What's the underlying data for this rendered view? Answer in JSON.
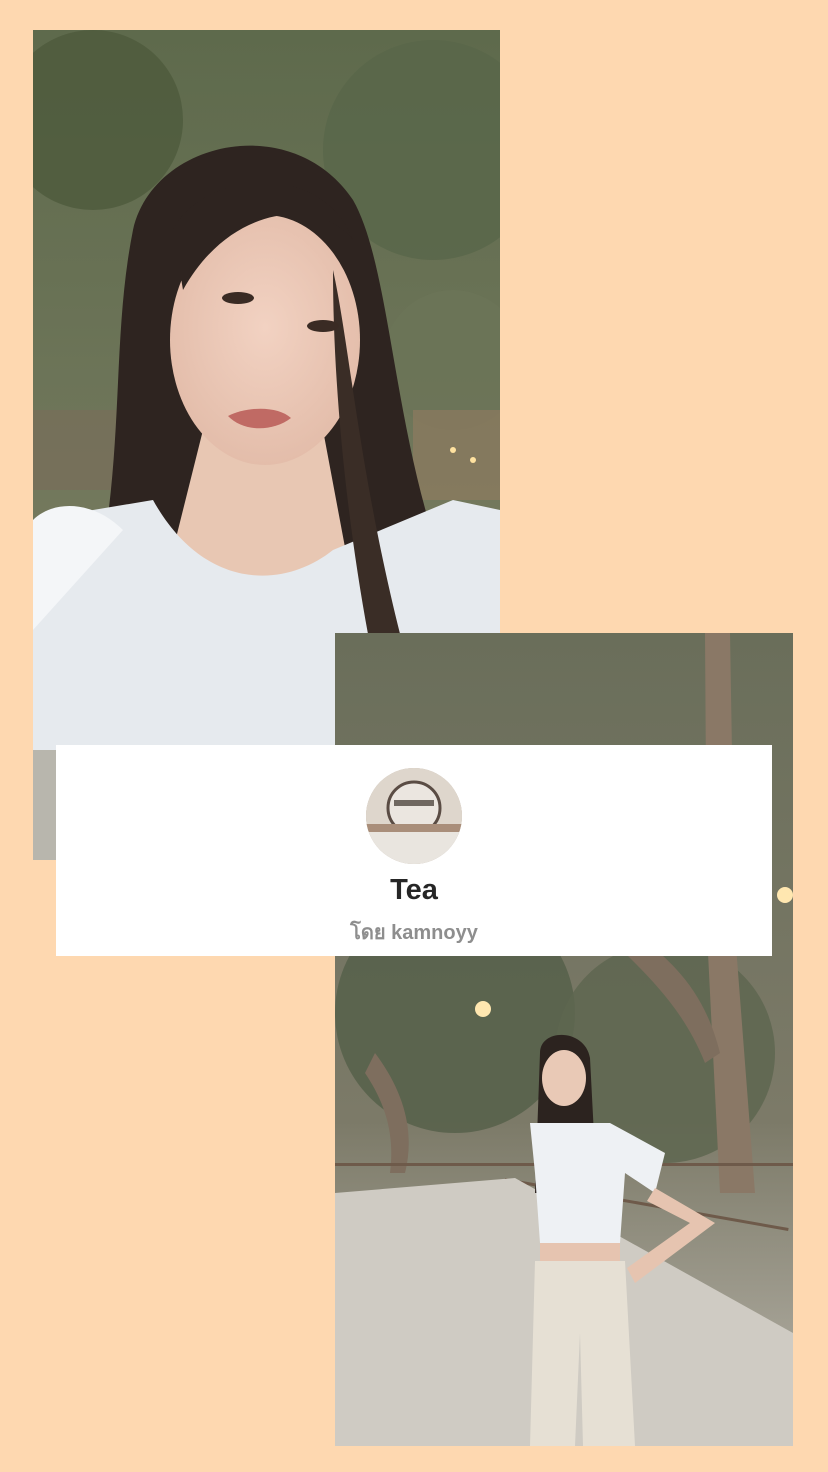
{
  "profile": {
    "name": "Tea",
    "byline": "โดย kamnoyy"
  },
  "colors": {
    "background": "#fed8b0",
    "card": "#ffffff",
    "title": "#262626",
    "subtitle": "#8e8e8e"
  }
}
